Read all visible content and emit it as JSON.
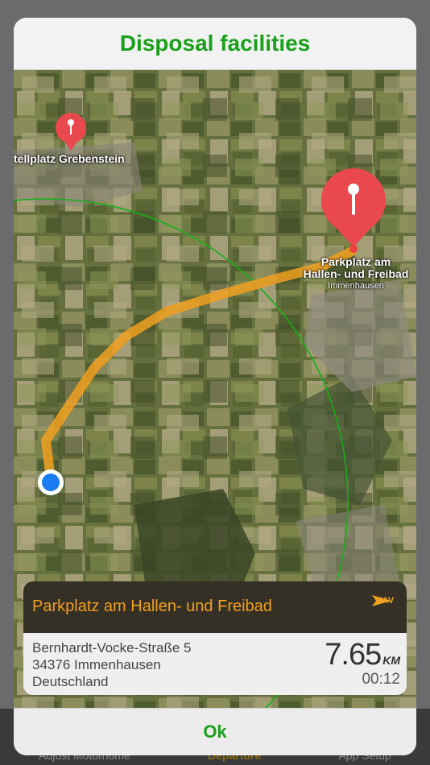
{
  "background_app": {
    "tabs": [
      "Adjust Motorhome",
      "Departure",
      "App Setup"
    ]
  },
  "modal": {
    "title": "Disposal facilities",
    "ok_label": "Ok"
  },
  "map": {
    "markers": [
      {
        "name": "Stellplatz Grebenstein",
        "visible_text": "tellplatz Grebenstein"
      },
      {
        "name": "Parkplatz am Hallen- und Freibad",
        "line1": "Parkplatz am",
        "line2": "Hallen- und Freibad",
        "subtitle": "Immenhausen"
      }
    ],
    "route_color": "#f0a020",
    "radius_color": "#18b018",
    "user_location_color": "#1a7cf0"
  },
  "destination": {
    "name": "Parkplatz am Hallen- und Freibad",
    "nav_label": "NAV",
    "address_line1": "Bernhardt-Vocke-Straße 5",
    "address_line2": "34376  Immenhausen",
    "address_line3": "Deutschland",
    "distance": "7.65",
    "distance_unit": "KM",
    "duration": "00:12"
  }
}
